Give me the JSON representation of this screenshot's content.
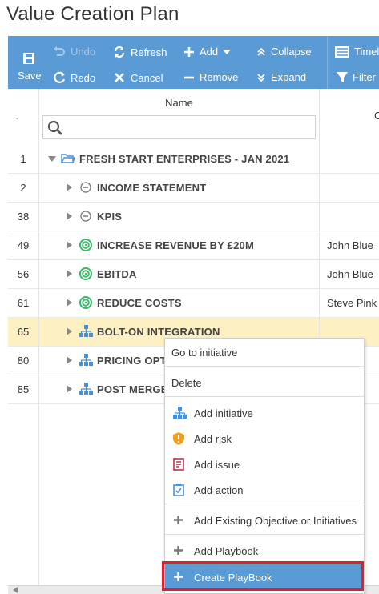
{
  "page_title": "Value Creation Plan",
  "toolbar": {
    "save": "Save",
    "undo": "Undo",
    "redo": "Redo",
    "refresh": "Refresh",
    "cancel": "Cancel",
    "add": "Add",
    "remove": "Remove",
    "collapse": "Collapse",
    "expand": "Expand",
    "timeline": "Timel",
    "filter": "Filter"
  },
  "grid": {
    "rownum_header": ".",
    "name_header": "Name",
    "owner_header": "C",
    "search_placeholder": "",
    "rows": [
      {
        "num": "1",
        "title": "FRESH START ENTERPRISES - JAN 2021",
        "owner": "",
        "icon": "folder-icon"
      },
      {
        "num": "2",
        "title": "INCOME STATEMENT",
        "owner": "",
        "icon": "circle-dot-icon"
      },
      {
        "num": "38",
        "title": "KPIS",
        "owner": "",
        "icon": "circle-dot-icon"
      },
      {
        "num": "49",
        "title": "INCREASE REVENUE BY £20M",
        "owner": "John Blue",
        "icon": "target-icon"
      },
      {
        "num": "56",
        "title": "EBITDA",
        "owner": "John Blue",
        "icon": "target-icon"
      },
      {
        "num": "61",
        "title": "REDUCE COSTS",
        "owner": "Steve Pink",
        "icon": "target-icon"
      },
      {
        "num": "65",
        "title": "BOLT-ON INTEGRATION",
        "owner": "",
        "icon": "hierarchy-icon"
      },
      {
        "num": "80",
        "title": "PRICING OPT",
        "owner": "",
        "icon": "hierarchy-icon"
      },
      {
        "num": "85",
        "title": "POST MERGE",
        "owner": "",
        "icon": "hierarchy-icon"
      }
    ]
  },
  "context_menu": {
    "go_to_initiative": "Go to initiative",
    "delete": "Delete",
    "add_initiative": "Add initiative",
    "add_risk": "Add risk",
    "add_issue": "Add issue",
    "add_action": "Add action",
    "add_existing": "Add Existing Objective or Initiatives",
    "add_playbook": "Add Playbook",
    "create_playbook": "Create PlayBook"
  },
  "colors": {
    "toolbar": "#5b9bd5",
    "selected_row": "#fdf0c2",
    "target_icon": "#3db86b",
    "hierarchy_icon": "#4a90d9",
    "risk_icon": "#f0a020",
    "issue_icon": "#c0304a",
    "highlight_outline": "#e0202a"
  }
}
